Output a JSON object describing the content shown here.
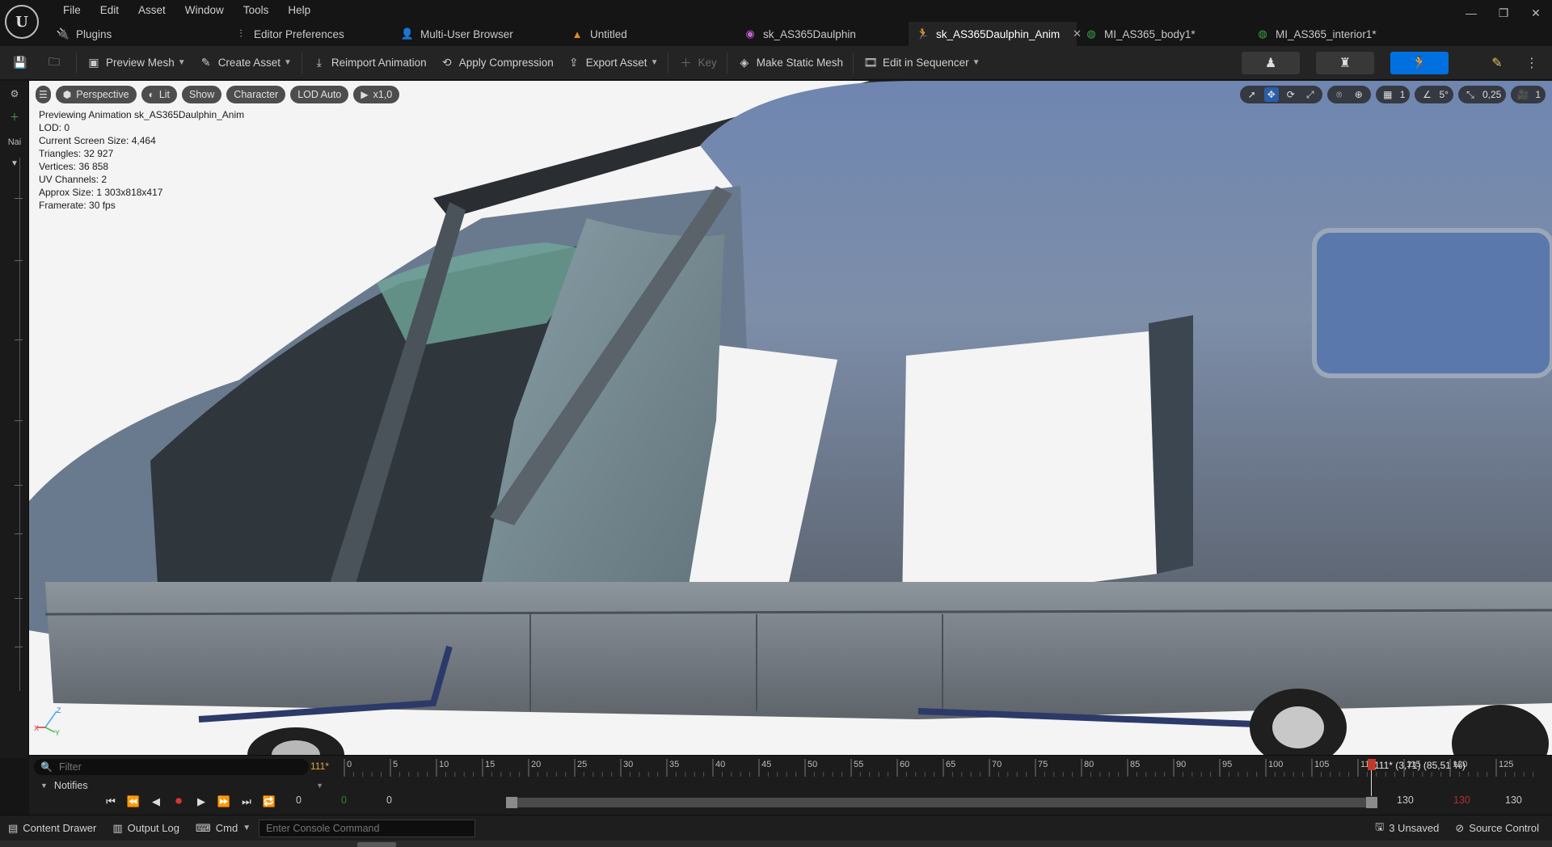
{
  "menu": [
    "File",
    "Edit",
    "Asset",
    "Window",
    "Tools",
    "Help"
  ],
  "doc_tabs": [
    {
      "label": "Plugins",
      "icon": "plug-icon"
    },
    {
      "label": "Editor Preferences",
      "icon": "sliders-icon"
    },
    {
      "label": "Multi-User Browser",
      "icon": "users-icon"
    },
    {
      "label": "Untitled",
      "icon": "level-icon"
    },
    {
      "label": "sk_AS365Daulphin",
      "icon": "skeleton-icon"
    },
    {
      "label": "sk_AS365Daulphin_Anim",
      "icon": "animation-icon",
      "active": true
    },
    {
      "label": "MI_AS365_body1*",
      "icon": "material-icon"
    },
    {
      "label": "MI_AS365_interior1*",
      "icon": "material-icon"
    }
  ],
  "toolbar": {
    "preview_mesh": "Preview Mesh",
    "create_asset": "Create Asset",
    "reimport_animation": "Reimport Animation",
    "apply_compression": "Apply Compression",
    "export_asset": "Export Asset",
    "key": "Key",
    "make_static_mesh": "Make Static Mesh",
    "edit_in_sequencer": "Edit in Sequencer"
  },
  "left_strip": {
    "label": "Nai"
  },
  "viewport": {
    "buttons": {
      "perspective": "Perspective",
      "lit": "Lit",
      "show": "Show",
      "character": "Character",
      "lod": "LOD Auto",
      "speed": "x1,0"
    },
    "right": {
      "grid": "1",
      "angle": "5°",
      "scale": "0,25",
      "camera": "1"
    },
    "stats": [
      "Previewing Animation sk_AS365Daulphin_Anim",
      "LOD: 0",
      "Current Screen Size: 4,464",
      "Triangles: 32 927",
      "Vertices: 36 858",
      "UV Channels: 2",
      "Approx Size: 1 303x818x417",
      "Framerate: 30 fps"
    ]
  },
  "timeline": {
    "filter_placeholder": "Filter",
    "current_frame": "111*",
    "notifies": "Notifies",
    "ticks": [
      "0",
      "5",
      "10",
      "15",
      "20",
      "25",
      "30",
      "35",
      "40",
      "45",
      "50",
      "55",
      "60",
      "65",
      "70",
      "75",
      "80",
      "85",
      "90",
      "95",
      "100",
      "105",
      "110",
      "115",
      "120",
      "125"
    ],
    "readout": "111* (3,71) (85,51 %)",
    "start_a": "0",
    "start_b": "0",
    "start_c": "0",
    "end_a": "130",
    "end_b": "130",
    "end_c": "130",
    "progress": 0.8551
  },
  "statusbar": {
    "content_drawer": "Content Drawer",
    "output_log": "Output Log",
    "cmd": "Cmd",
    "console_placeholder": "Enter Console Command",
    "unsaved": "3 Unsaved",
    "source_control": "Source Control"
  },
  "colors": {
    "accent": "#0070e0",
    "frame_orange": "#e8a53a",
    "start_green": "#2a8a2a",
    "end_red": "#b03030"
  }
}
